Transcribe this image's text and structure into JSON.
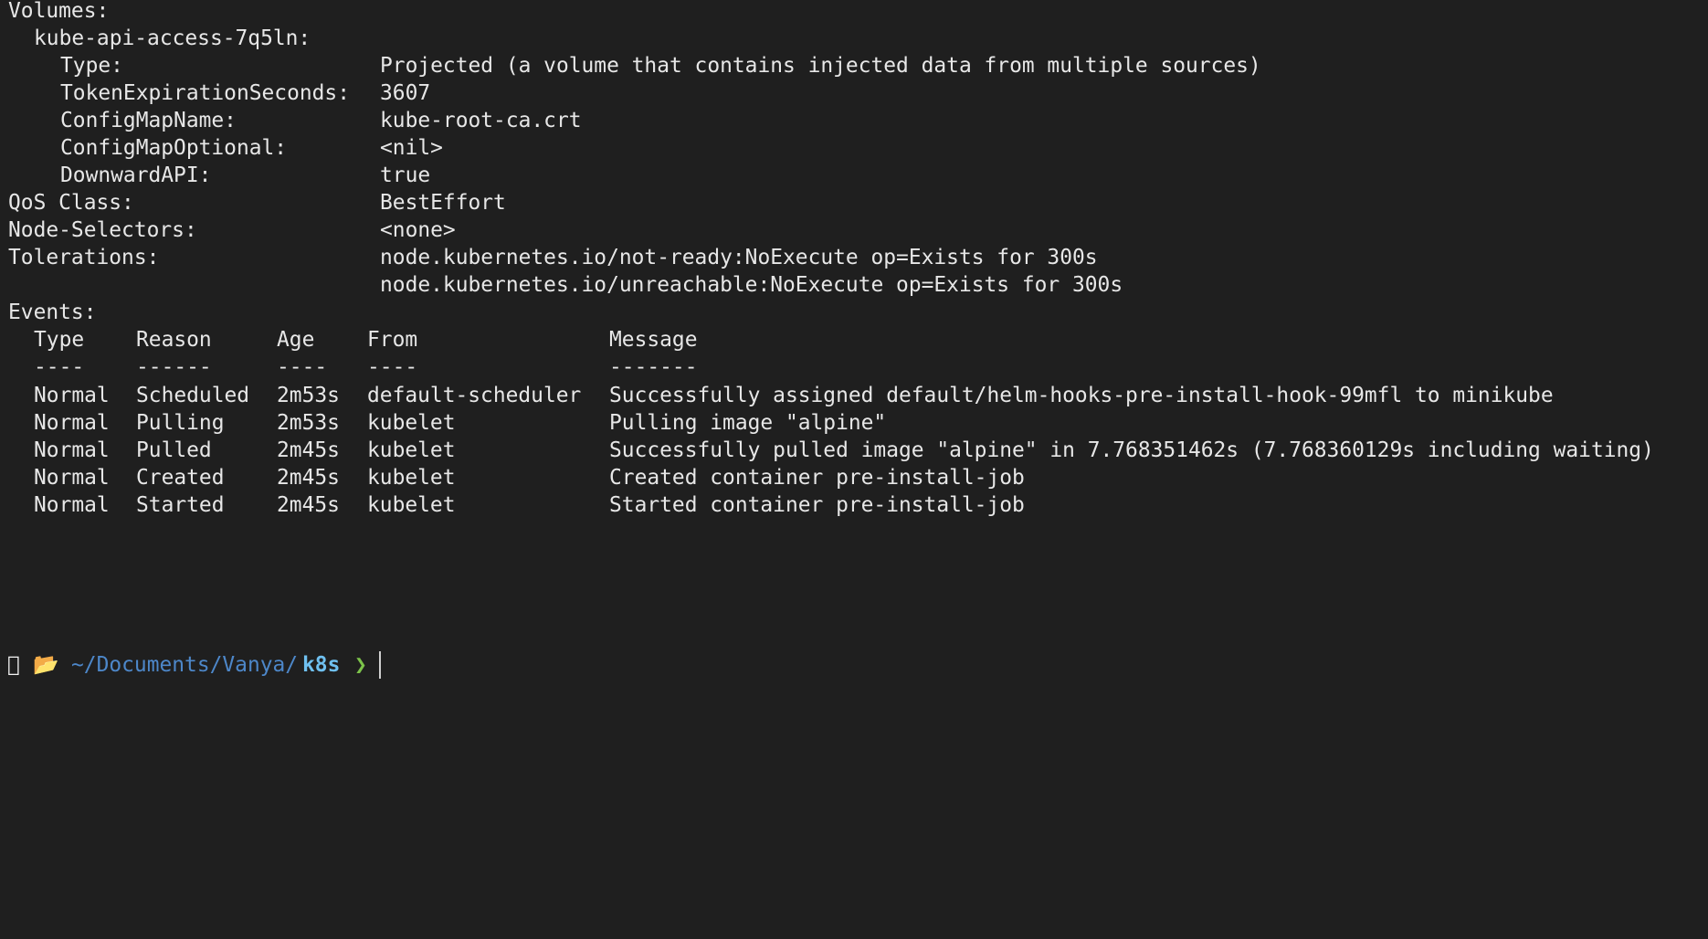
{
  "volumes": {
    "header": "Volumes:",
    "name": "kube-api-access-7q5ln:",
    "fields": [
      {
        "key": "Type:",
        "value": "Projected (a volume that contains injected data from multiple sources)"
      },
      {
        "key": "TokenExpirationSeconds:",
        "value": "3607"
      },
      {
        "key": "ConfigMapName:",
        "value": "kube-root-ca.crt"
      },
      {
        "key": "ConfigMapOptional:",
        "value": "<nil>"
      },
      {
        "key": "DownwardAPI:",
        "value": "true"
      }
    ]
  },
  "qos": {
    "key": "QoS Class:",
    "value": "BestEffort"
  },
  "node_selectors": {
    "key": "Node-Selectors:",
    "value": "<none>"
  },
  "tolerations": {
    "key": "Tolerations:",
    "values": [
      "node.kubernetes.io/not-ready:NoExecute op=Exists for 300s",
      "node.kubernetes.io/unreachable:NoExecute op=Exists for 300s"
    ]
  },
  "events": {
    "header": "Events:",
    "columns": [
      "Type",
      "Reason",
      "Age",
      "From",
      "Message"
    ],
    "separators": [
      "----",
      "------",
      "----",
      "----",
      "-------"
    ],
    "rows": [
      [
        "Normal",
        "Scheduled",
        "2m53s",
        "default-scheduler",
        "Successfully assigned default/helm-hooks-pre-install-hook-99mfl to minikube"
      ],
      [
        "Normal",
        "Pulling",
        "2m53s",
        "kubelet",
        "Pulling image \"alpine\""
      ],
      [
        "Normal",
        "Pulled",
        "2m45s",
        "kubelet",
        "Successfully pulled image \"alpine\" in 7.768351462s (7.768360129s including waiting)"
      ],
      [
        "Normal",
        "Created",
        "2m45s",
        "kubelet",
        "Created container pre-install-job"
      ],
      [
        "Normal",
        "Started",
        "2m45s",
        "kubelet",
        "Started container pre-install-job"
      ]
    ]
  },
  "prompt": {
    "apple_icon": "",
    "folder_icon": "📂",
    "path": "~/Documents/Vanya/",
    "current_dir": "k8s",
    "arrow": "❯"
  },
  "colors": {
    "background": "#1f1f1f",
    "text": "#e7e7e7",
    "path": "#4d87c9",
    "current_dir": "#6fc0f0",
    "prompt_arrow": "#7cc34a"
  }
}
